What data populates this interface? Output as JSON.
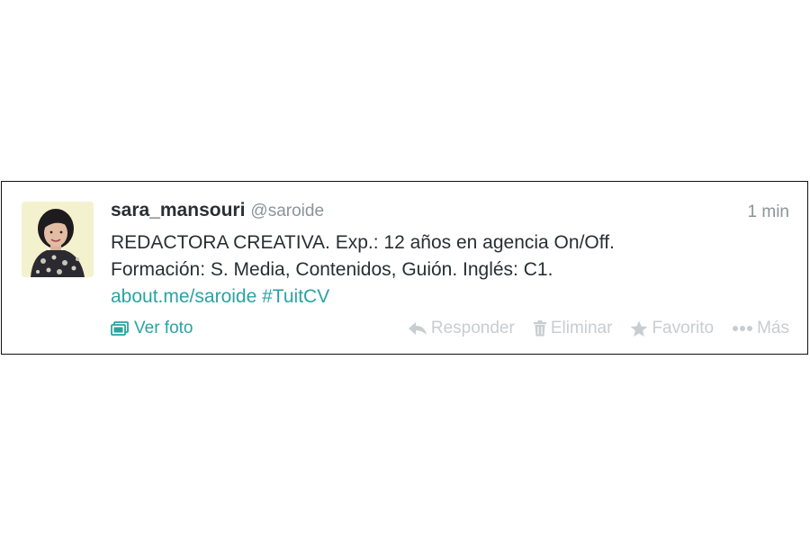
{
  "tweet": {
    "display_name": "sara_mansouri",
    "handle": "@saroide",
    "timestamp": "1 min",
    "text_lines": [
      "REDACTORA CREATIVA. Exp.: 12 años en agencia On/Off.",
      "Formación: S. Media, Contenidos, Guión. Inglés: C1."
    ],
    "link_url_text": "about.me/saroide",
    "hashtag": "#TuitCV"
  },
  "actions": {
    "view_photo": {
      "label": "Ver foto",
      "icon": "photo-icon"
    },
    "reply": {
      "label": "Responder",
      "icon": "reply-icon"
    },
    "delete": {
      "label": "Eliminar",
      "icon": "trash-icon"
    },
    "favorite": {
      "label": "Favorito",
      "icon": "star-icon"
    },
    "more": {
      "label": "Más",
      "icon": "more-dots-icon"
    }
  },
  "colors": {
    "link": "#2aa3a3",
    "muted": "#8a9499",
    "action_inactive": "#c8cdd0",
    "text": "#292f33"
  }
}
